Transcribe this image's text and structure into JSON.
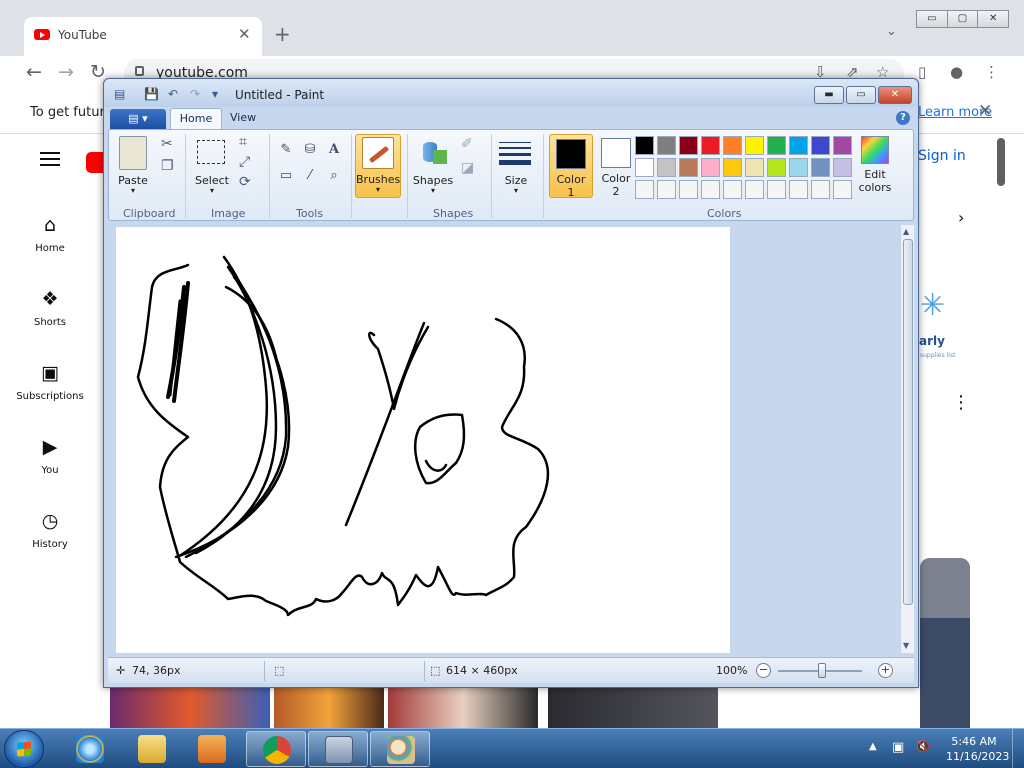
{
  "browser": {
    "tab": {
      "title": "YouTube",
      "close": "✕"
    },
    "new_tab": "+",
    "tab_search": "⌄",
    "window_buttons": [
      "▭",
      "▢",
      "✕"
    ],
    "nav": {
      "back": "←",
      "forward": "→",
      "reload": "↻"
    },
    "url": "youtube.com",
    "toolbar_icons": [
      "⇩",
      "⇗",
      "☆",
      "▯",
      "●",
      "⋮"
    ],
    "infobar": {
      "text": "To get future",
      "link": "Learn more",
      "close": "✕"
    }
  },
  "youtube": {
    "sign_in": "Sign in",
    "nav": [
      {
        "label": "Home",
        "icon": "⌂"
      },
      {
        "label": "Shorts",
        "icon": "❖"
      },
      {
        "label": "Subscriptions",
        "icon": "▣"
      },
      {
        "label": "You",
        "icon": "▶"
      },
      {
        "label": "History",
        "icon": "◷"
      }
    ],
    "chevron": "›",
    "ad_mark": "✳",
    "ad_text": "arly",
    "ad_small": "supplies list",
    "kebab": "⋮"
  },
  "paint": {
    "title": "Untitled - Paint",
    "quick_access": [
      "▤",
      "💾",
      "↶",
      "↷",
      "▾"
    ],
    "window_controls": [
      "▬",
      "▭",
      "✕"
    ],
    "file_menu": "▤ ▾",
    "tabs": [
      "Home",
      "View"
    ],
    "help": "?",
    "groups": {
      "clipboard": "Clipboard",
      "image": "Image",
      "tools": "Tools",
      "shapes": "Shapes",
      "colors": "Colors"
    },
    "buttons": {
      "paste": "Paste",
      "select": "Select",
      "brushes": "Brushes",
      "shapes": "Shapes",
      "size": "Size",
      "color1_line1": "Color",
      "color1_line2": "1",
      "color2_line1": "Color",
      "color2_line2": "2",
      "edit_colors_line1": "Edit",
      "edit_colors_line2": "colors"
    },
    "tool_icons": [
      "✎",
      "⛁",
      "A",
      "▭",
      "⁄",
      "⌕"
    ],
    "clipboard_icons": [
      "✂",
      "❐"
    ],
    "image_icons": [
      "⌗",
      "⤢",
      "⟳"
    ],
    "shape_icons": [
      "✐",
      "◪"
    ],
    "colors": {
      "color1": "#000000",
      "color2": "#ffffff",
      "palette_row1": [
        "#000000",
        "#7f7f7f",
        "#880015",
        "#ed1c24",
        "#ff7f27",
        "#fff200",
        "#22b14c",
        "#00a2e8",
        "#3f48cc",
        "#a349a4"
      ],
      "palette_row2": [
        "#ffffff",
        "#c3c3c3",
        "#b97a57",
        "#ffaec9",
        "#ffc90e",
        "#efe4b0",
        "#b5e61d",
        "#99d9ea",
        "#7092be",
        "#c8bfe7"
      ],
      "palette_row3": [
        "#f5f5f5",
        "#f5f5f5",
        "#f5f5f5",
        "#f5f5f5",
        "#f5f5f5",
        "#f5f5f5",
        "#f5f5f5",
        "#f5f5f5",
        "#f5f5f5",
        "#f5f5f5"
      ]
    },
    "status": {
      "cursor": "74, 36px",
      "canvas_size": "614 × 460px",
      "zoom": "100%",
      "zoom_out": "−",
      "zoom_in": "+"
    }
  },
  "taskbar": {
    "apps": [
      "internet-explorer",
      "file-explorer",
      "media-player",
      "chrome",
      "calculator",
      "paint"
    ],
    "tray_arrow": "▲",
    "tray_icons": [
      "▣",
      "🔇"
    ],
    "time": "5:46 AM",
    "date": "11/16/2023"
  }
}
